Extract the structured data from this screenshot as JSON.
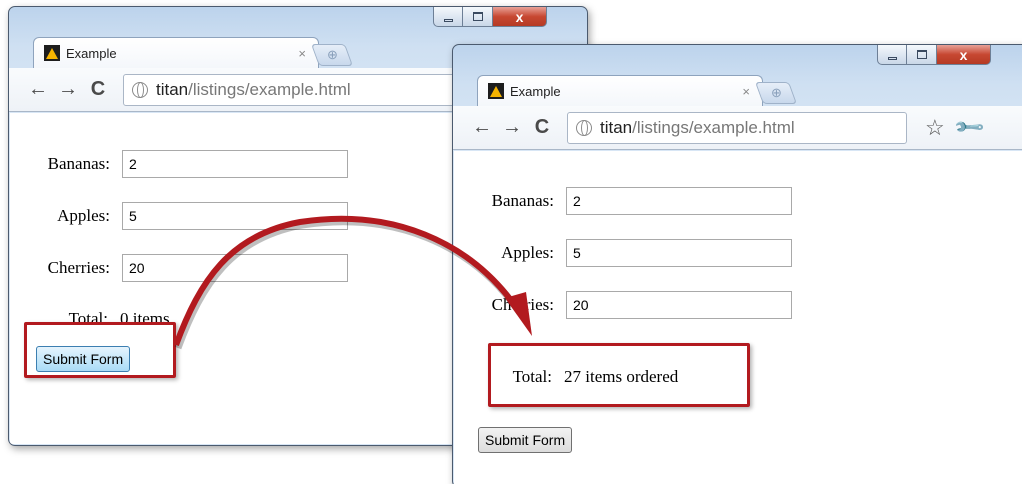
{
  "colors": {
    "highlight": "#b21a1f",
    "window_frame": "#cfe0f2",
    "button_hover": "#a9dbf6"
  },
  "windows": [
    {
      "tab_title": "Example",
      "tab_close": "×",
      "new_tab_icon": "⊕",
      "url_host": "titan",
      "url_path": "/listings/example.html",
      "fields": [
        {
          "label": "Bananas:",
          "value": "2"
        },
        {
          "label": "Apples:",
          "value": "5"
        },
        {
          "label": "Cherries:",
          "value": "20"
        }
      ],
      "total_label": "Total:",
      "total_value": "0 items",
      "submit_label": "Submit Form"
    },
    {
      "tab_title": "Example",
      "tab_close": "×",
      "new_tab_icon": "⊕",
      "url_host": "titan",
      "url_path": "/listings/example.html",
      "fields": [
        {
          "label": "Bananas:",
          "value": "2"
        },
        {
          "label": "Apples:",
          "value": "5"
        },
        {
          "label": "Cherries:",
          "value": "20"
        }
      ],
      "total_label": "Total:",
      "total_value": "27 items ordered",
      "submit_label": "Submit Form"
    }
  ],
  "icons": {
    "back": "←",
    "forward": "→",
    "reload": "C",
    "star": "☆",
    "wrench": "🔧",
    "close": "x"
  }
}
